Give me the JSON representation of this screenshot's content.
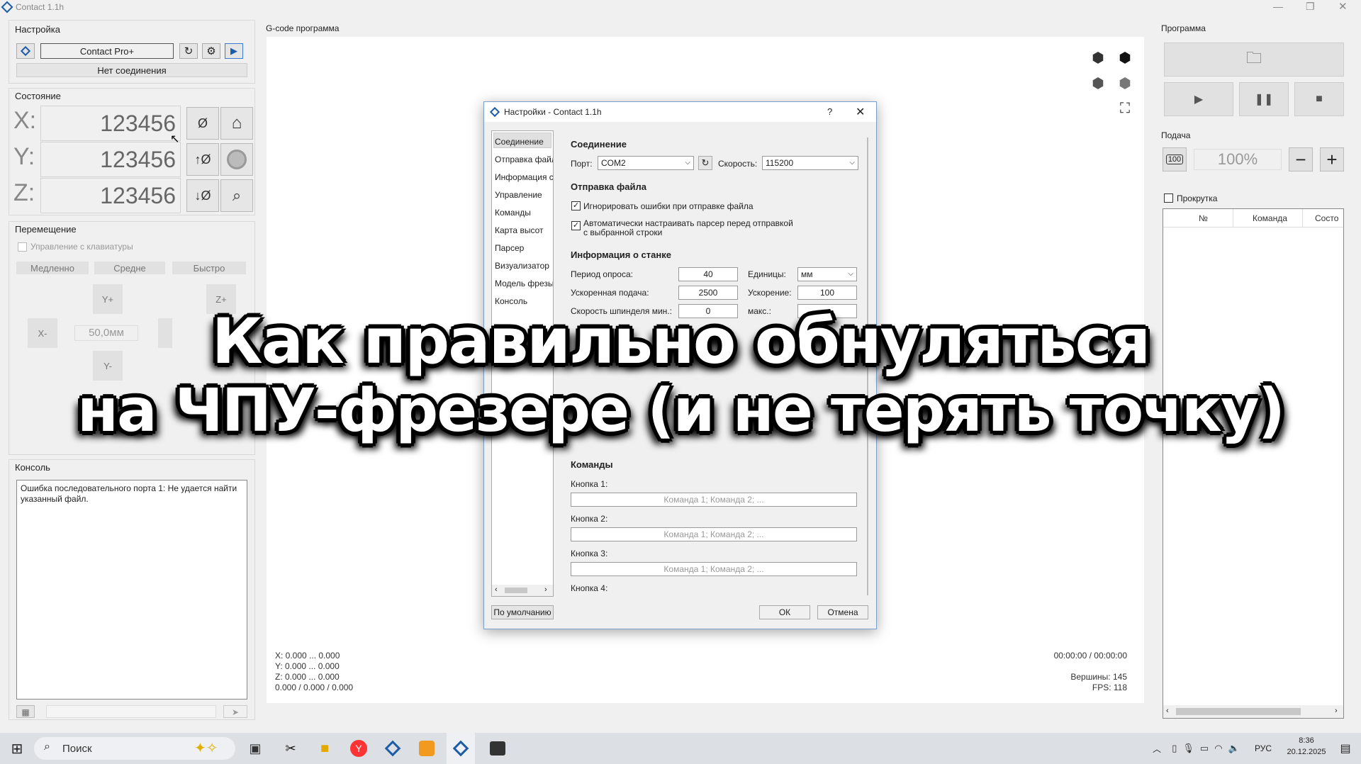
{
  "window": {
    "title": "Contact 1.1h"
  },
  "settings": {
    "title": "Настройка",
    "device": "Contact Pro+",
    "status": "Нет соединения"
  },
  "state": {
    "title": "Состояние",
    "x_label": "X:",
    "y_label": "Y:",
    "z_label": "Z:",
    "x": "123456",
    "y": "123456",
    "z": "123456"
  },
  "move": {
    "title": "Перемещение",
    "keyboard": "Управление с клавиатуры",
    "slow": "Медленно",
    "medium": "Средне",
    "fast": "Быстро",
    "yplus": "Y+",
    "yminus": "Y-",
    "xminus": "X-",
    "zplus": "Z+",
    "step": "50,0мм"
  },
  "console": {
    "title": "Консоль",
    "text": "Ошибка последовательного порта 1: Не удается найти указанный файл."
  },
  "gcode": {
    "title": "G-code программа",
    "x_range": "X: 0.000 ... 0.000",
    "y_range": "Y: 0.000 ... 0.000",
    "z_range": "Z: 0.000 ... 0.000",
    "pos": "0.000 / 0.000 / 0.000",
    "time": "00:00:00 / 00:00:00",
    "vertices": "Вершины: 145",
    "fps": "FPS: 118"
  },
  "program": {
    "title": "Программа"
  },
  "feed": {
    "title": "Подача",
    "badge": "100",
    "value": "100%"
  },
  "table": {
    "scroll_label": "Прокрутка",
    "columns": [
      "№",
      "Команда",
      "Состо"
    ]
  },
  "dialog": {
    "title": "Настройки - Contact 1.1h",
    "help": "?",
    "nav": [
      "Соединение",
      "Отправка файл",
      "Информация с",
      "Управление",
      "Команды",
      "Карта высот",
      "Парсер",
      "Визуализатор",
      "Модель фрезы",
      "Консоль"
    ],
    "sec_connection": "Соединение",
    "port_label": "Порт:",
    "port": "COM2",
    "speed_label": "Скорость:",
    "speed": "115200",
    "sec_send": "Отправка файла",
    "ignore_errors": "Игнорировать ошибки при отправке файла",
    "auto_parser_1": "Автоматически настраивать парсер перед отправкой",
    "auto_parser_2": "с выбранной строки",
    "sec_machine": "Информация о станке",
    "poll_label": "Период опроса:",
    "poll": "40",
    "units_label": "Единицы:",
    "units": "мм",
    "rapid_label": "Ускоренная подача:",
    "rapid": "2500",
    "accel_label": "Ускорение:",
    "accel": "100",
    "spindle_label": "Скорость шпинделя мин.:",
    "spindle_min": "0",
    "max_label": "макс.:",
    "sec_commands": "Команды",
    "b1": "Кнопка 1:",
    "b2": "Кнопка 2:",
    "b3": "Кнопка 3:",
    "b4": "Кнопка 4:",
    "placeholder": "Команда 1; Команда 2; ...",
    "defaults": "По умолчанию",
    "ok": "ОК",
    "cancel": "Отмена"
  },
  "overlay": {
    "line1": "Как правильно обнуляться",
    "line2": "на ЧПУ-фрезере (и не терять точку)"
  },
  "taskbar": {
    "search": "Поиск",
    "lang": "РУС",
    "time": "8:36",
    "date": "20.12.2025"
  }
}
